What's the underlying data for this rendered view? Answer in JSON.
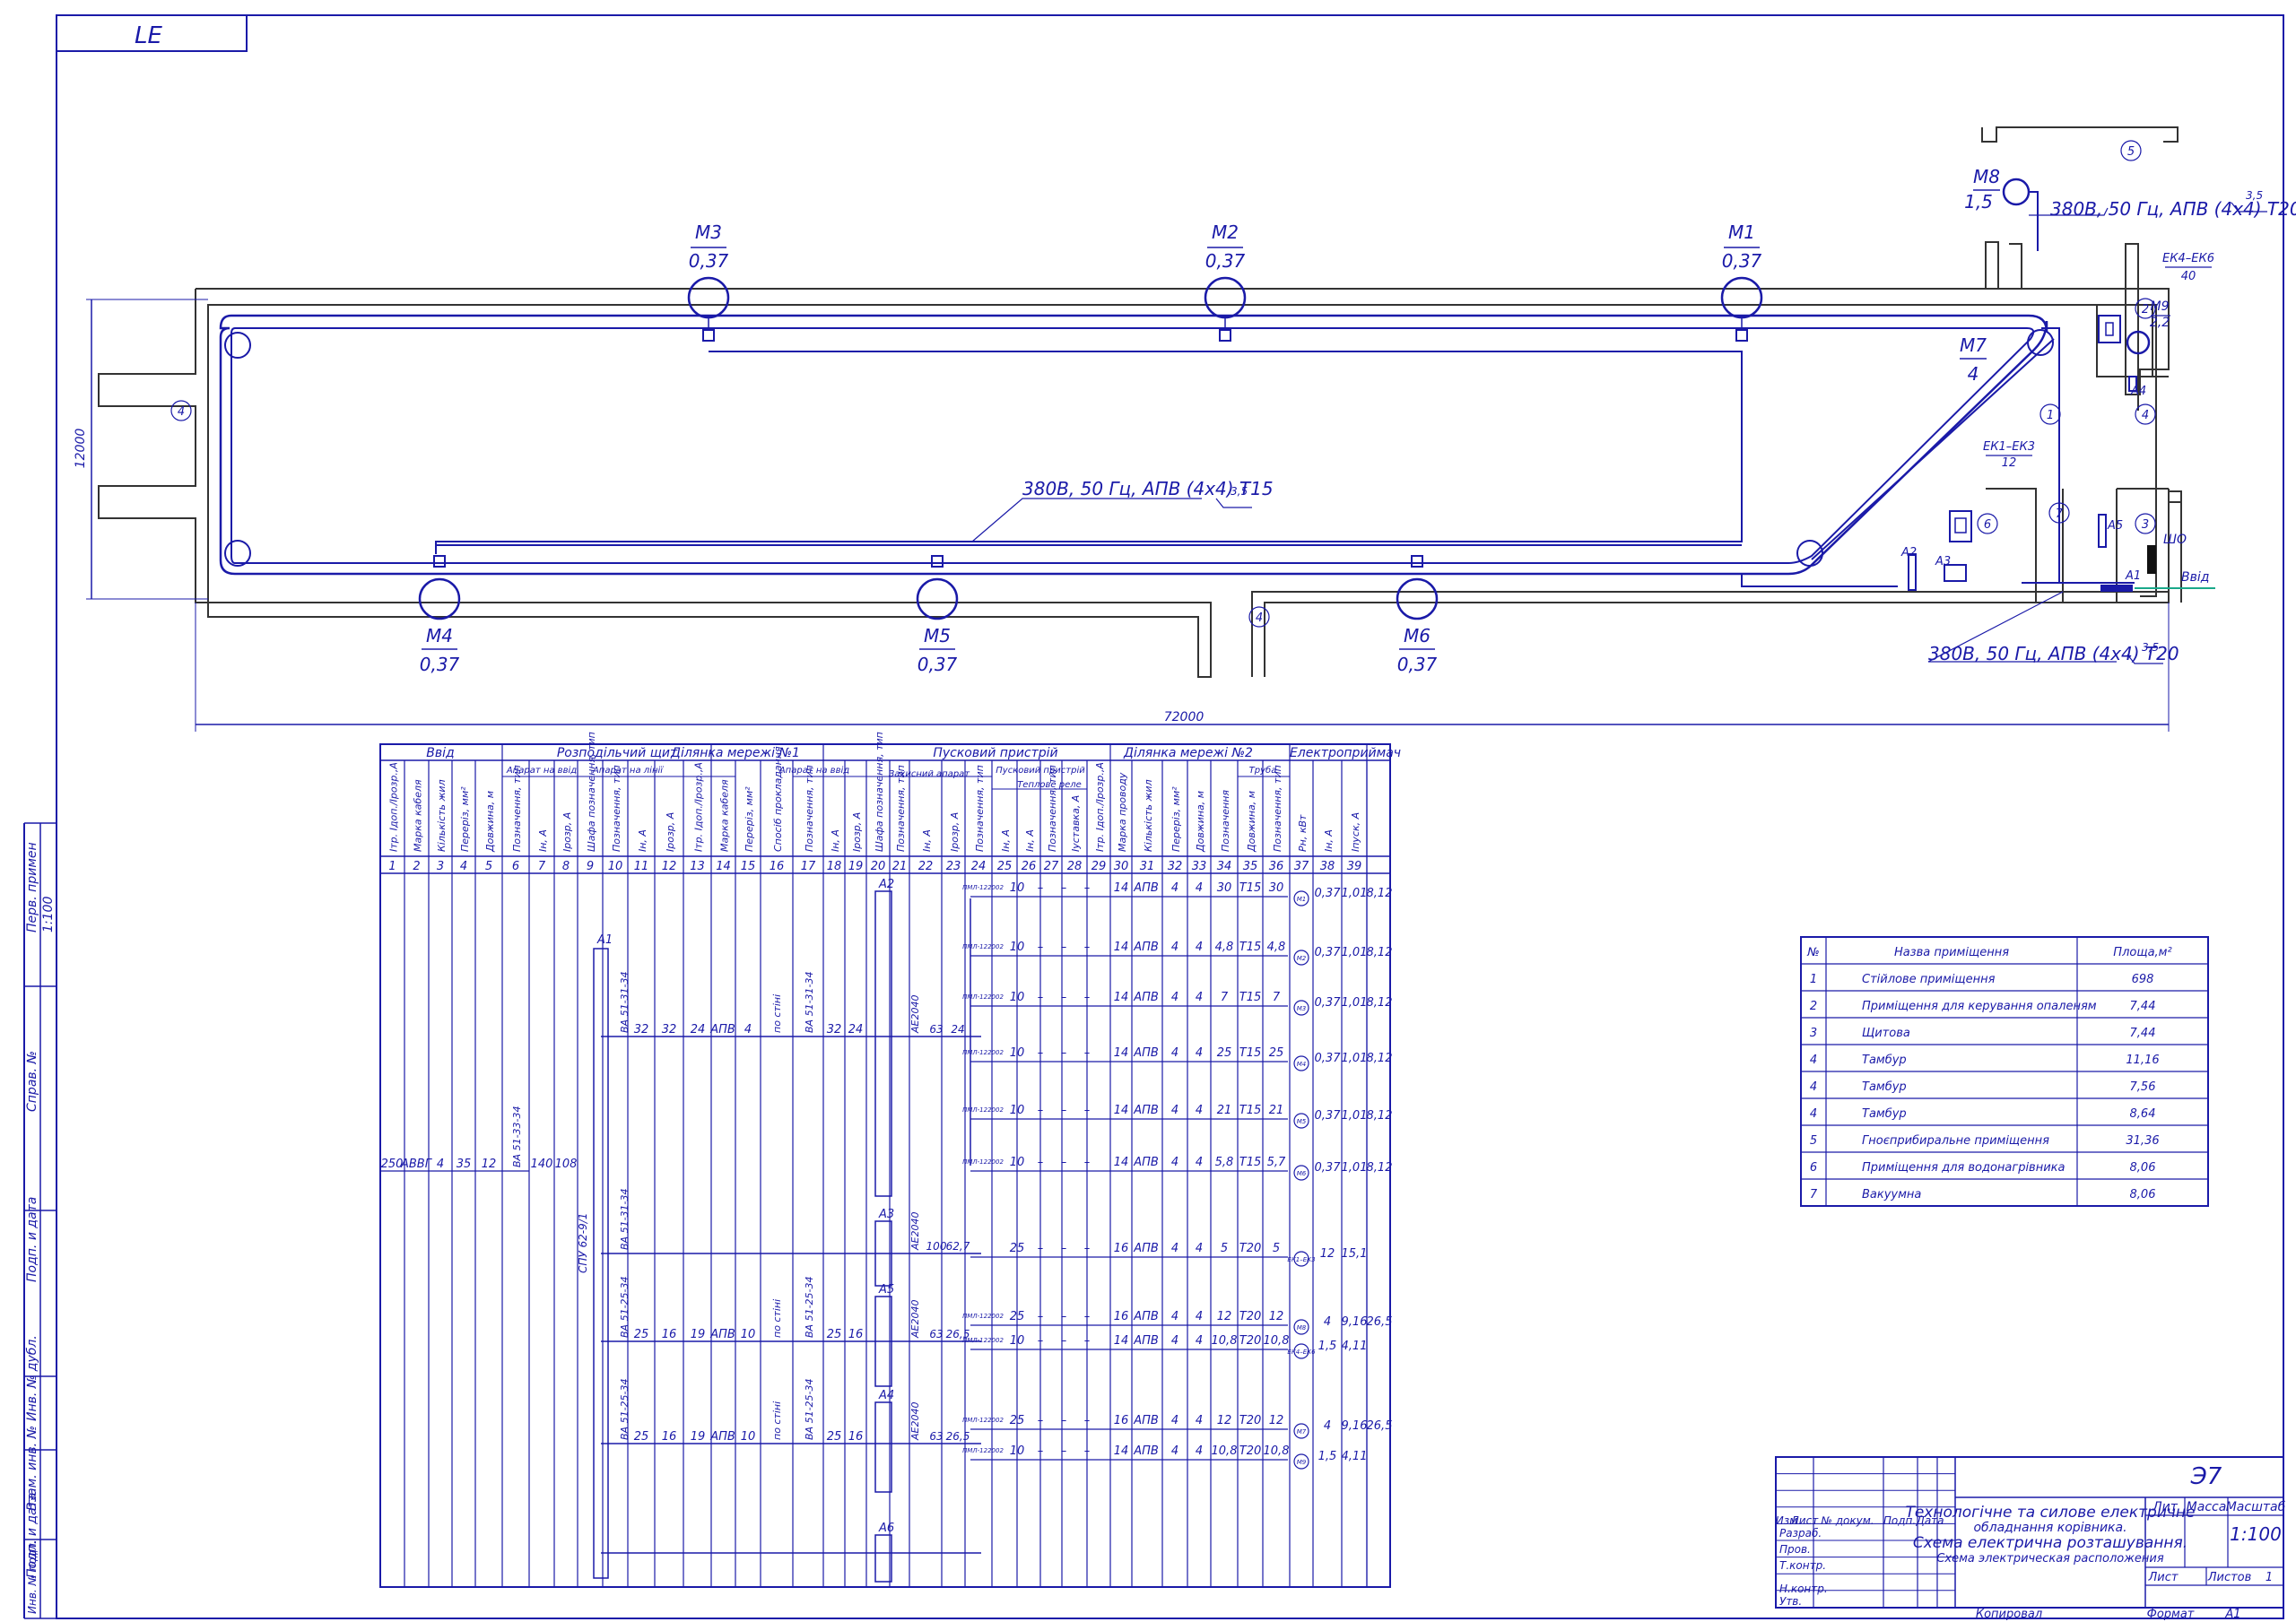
{
  "colors": {
    "frame": "#1a1aa8",
    "wall": "#333333",
    "feed": "#1aa88a",
    "paper": "#ffffff"
  },
  "sheet_code": "LE",
  "left_stamp": [
    "Перв. примен",
    "1:100",
    "Справ. №",
    "Подп. и дата",
    "Инв. № дубл.",
    "Взам. инв. №",
    "Подп. и дата",
    "Инв. № подл."
  ],
  "plan": {
    "motors": [
      {
        "id": "M3",
        "power": "0,37"
      },
      {
        "id": "M2",
        "power": "0,37"
      },
      {
        "id": "M1",
        "power": "0,37"
      },
      {
        "id": "M4",
        "power": "0,37"
      },
      {
        "id": "M5",
        "power": "0,37"
      },
      {
        "id": "M6",
        "power": "0,37"
      },
      {
        "id": "M7",
        "power": "4"
      },
      {
        "id": "M8",
        "power": "1,5"
      },
      {
        "id": "M9",
        "power": "2,2"
      }
    ],
    "heaters": [
      {
        "id": "ЕК4–ЕК6",
        "power": "40"
      },
      {
        "id": "ЕК1–ЕК3",
        "power": "12"
      }
    ],
    "cable_labels": [
      "380В, 50 Гц, АПВ (4х4) Т20",
      "380В, 50 Гц, АПВ (4х4) Т15",
      "380В, 50 Гц, АПВ (4х4) Т20"
    ],
    "cable_marks": [
      "3,5",
      "3,5",
      "3,5"
    ],
    "dim_width": "72000",
    "dim_height": "12000",
    "devices": [
      "А1",
      "А2",
      "А3",
      "А4",
      "А5",
      "ШО"
    ],
    "input_label": "Ввід",
    "room_numbers": [
      "1",
      "2",
      "3",
      "4",
      "4",
      "4",
      "5",
      "6",
      "7"
    ]
  },
  "schedule": {
    "groups": [
      "Ввід",
      "Розподільчий щит",
      "Ділянка мережі №1",
      "Пусковий пристрій",
      "Ділянка мережі №2",
      "Електроприймач"
    ],
    "subgroups": [
      "Апарат на ввід",
      "Апарат на лінії",
      "Апарат на ввід",
      "Захисний апарат",
      "Пусковий пристрій",
      "Теплове реле",
      "Труба"
    ],
    "col_numbers": [
      "1",
      "2",
      "3",
      "4",
      "5",
      "6",
      "7",
      "8",
      "9",
      "10",
      "11",
      "12",
      "13",
      "14",
      "15",
      "16",
      "17",
      "18",
      "19",
      "20",
      "21",
      "22",
      "23",
      "24",
      "25",
      "26",
      "27",
      "28",
      "29",
      "30",
      "31",
      "32",
      "33",
      "34",
      "35",
      "36",
      "37",
      "38",
      "39"
    ],
    "headers": [
      "Ітр. Ідоп./Ірозр.,А",
      "Марка кабеля",
      "Кількість жил",
      "Переріз, мм²",
      "Довжина, м",
      "Позначення, тип",
      "Ін, А",
      "Ірозр, А",
      "Шафа позначення, тип",
      "Позначення, тип",
      "Ін, А",
      "Ірозр, А",
      "Ітр. Ідоп./Ірозр.,А",
      "Марка кабеля",
      "Переріз, мм²",
      "Спосіб прокладання",
      "Позначення, тип",
      "Ін, А",
      "Ірозр, А",
      "Шафа позначення, тип",
      "Позначення, тип",
      "Ін, А",
      "Ірозр, А",
      "Позначення, тип",
      "Ін, А",
      "Ін, А",
      "Позначення, тип",
      "Іуставка, А",
      "Ітр. Ідоп./Ірозр.,А",
      "Марка проводу",
      "Кількість жил",
      "Переріз, мм²",
      "Довжина, м",
      "Позначення",
      "Довжина, м",
      "Позначення, тип",
      "Рн, кВт",
      "Ін, А",
      "Іпуск, А"
    ],
    "input_row": {
      "i": "250",
      "cable": "АВВГ",
      "cores": "4",
      "section": "35",
      "length": "12",
      "breaker": "ВА 51-33-34",
      "in": "140",
      "ir": "108",
      "cabinet": "СПУ 62-9/1"
    },
    "sections": [
      {
        "breaker": "ВА 51-31-34",
        "in": "32",
        "ir": "32",
        "i13": "24",
        "cable": "АПВ",
        "s": "4",
        "way": "по стіні",
        "b2": "ВА 51-31-34",
        "in2": "32",
        "ir2": "24",
        "box": "А2",
        "p": "АЕ2040",
        "pin": "63",
        "pir": "24"
      },
      {
        "breaker": "ВА 51-31-34",
        "box": "А3",
        "p": "АЕ2040",
        "pin": "100",
        "pir": "62,7"
      },
      {
        "breaker": "ВА 51-25-34",
        "in": "25",
        "ir": "16",
        "i13": "19",
        "cable": "АПВ",
        "s": "10",
        "way": "по стіні",
        "b2": "ВА 51-25-34",
        "in2": "25",
        "ir2": "16",
        "box": "А5",
        "p": "АЕ2040",
        "pin": "63",
        "pir": "26,5"
      },
      {
        "breaker": "ВА 51-25-34",
        "in": "25",
        "ir": "16",
        "i13": "19",
        "cable": "АПВ",
        "s": "10",
        "way": "по стіні",
        "b2": "ВА 51-25-34",
        "in2": "25",
        "ir2": "16",
        "box": "А4",
        "p": "АЕ2040",
        "pin": "63",
        "pir": "26,5"
      }
    ],
    "cabinet_extra": [
      "А1",
      "А6"
    ],
    "rows": [
      {
        "starter": "ПМЛ-122002",
        "nc": "10",
        "i": "14",
        "w": "АПВ",
        "n": "4",
        "s": "4",
        "len": "30",
        "pipe": "Т15",
        "plen": "30",
        "m": "М1",
        "p": "0,37",
        "in": "1,01",
        "ip": "8,12"
      },
      {
        "starter": "ПМЛ-122002",
        "nc": "10",
        "i": "14",
        "w": "АПВ",
        "n": "4",
        "s": "4",
        "len": "4,8",
        "pipe": "Т15",
        "plen": "4,8",
        "m": "М2",
        "p": "0,37",
        "in": "1,01",
        "ip": "8,12"
      },
      {
        "starter": "ПМЛ-122002",
        "nc": "10",
        "i": "14",
        "w": "АПВ",
        "n": "4",
        "s": "4",
        "len": "7",
        "pipe": "Т15",
        "plen": "7",
        "m": "М3",
        "p": "0,37",
        "in": "1,01",
        "ip": "8,12"
      },
      {
        "starter": "ПМЛ-122002",
        "nc": "10",
        "i": "14",
        "w": "АПВ",
        "n": "4",
        "s": "4",
        "len": "25",
        "pipe": "Т15",
        "plen": "25",
        "m": "М4",
        "p": "0,37",
        "in": "1,01",
        "ip": "8,12"
      },
      {
        "starter": "ПМЛ-122002",
        "nc": "10",
        "i": "14",
        "w": "АПВ",
        "n": "4",
        "s": "4",
        "len": "21",
        "pipe": "Т15",
        "plen": "21",
        "m": "М5",
        "p": "0,37",
        "in": "1,01",
        "ip": "8,12"
      },
      {
        "starter": "ПМЛ-122002",
        "nc": "10",
        "i": "14",
        "w": "АПВ",
        "n": "4",
        "s": "4",
        "len": "5,8",
        "pipe": "Т15",
        "plen": "5,7",
        "m": "М6",
        "p": "0,37",
        "in": "1,01",
        "ip": "8,12"
      },
      {
        "starter": "",
        "nc": "25",
        "i": "16",
        "w": "АПВ",
        "n": "4",
        "s": "4",
        "len": "5",
        "pipe": "Т20",
        "plen": "5",
        "m": "ЕК1–ЕК3",
        "p": "12",
        "in": "15,1",
        "ip": ""
      },
      {
        "starter": "ПМЛ-122002",
        "nc": "25",
        "i": "16",
        "w": "АПВ",
        "n": "4",
        "s": "4",
        "len": "12",
        "pipe": "Т20",
        "plen": "12",
        "m": "М8",
        "p": "4",
        "in": "9,16",
        "ip": "26,5"
      },
      {
        "starter": "ПМЛ-122002",
        "nc": "10",
        "i": "14",
        "w": "АПВ",
        "n": "4",
        "s": "4",
        "len": "10,8",
        "pipe": "Т20",
        "plen": "10,8",
        "m": "ЕК4–ЕК6",
        "p": "1,5",
        "in": "4,11",
        "ip": ""
      },
      {
        "starter": "ПМЛ-122002",
        "nc": "25",
        "i": "16",
        "w": "АПВ",
        "n": "4",
        "s": "4",
        "len": "12",
        "pipe": "Т20",
        "plen": "12",
        "m": "М7",
        "p": "4",
        "in": "9,16",
        "ip": "26,5"
      },
      {
        "starter": "ПМЛ-122002",
        "nc": "10",
        "i": "14",
        "w": "АПВ",
        "n": "4",
        "s": "4",
        "len": "10,8",
        "pipe": "Т20",
        "plen": "10,8",
        "m": "М9",
        "p": "1,5",
        "in": "4,11",
        "ip": ""
      }
    ],
    "dash": "–"
  },
  "rooms": {
    "headers": [
      "№",
      "Назва приміщення",
      "Площа,м²"
    ],
    "rows": [
      [
        "1",
        "Стійлове приміщення",
        "698"
      ],
      [
        "2",
        "Приміщення для керування опаленям",
        "7,44"
      ],
      [
        "3",
        "Щитова",
        "7,44"
      ],
      [
        "4",
        "Тамбур",
        "11,16"
      ],
      [
        "4",
        "Тамбур",
        "7,56"
      ],
      [
        "4",
        "Тамбур",
        "8,64"
      ],
      [
        "5",
        "Гноєприбиральне приміщення",
        "31,36"
      ],
      [
        "6",
        "Приміщення для водонагрівника",
        "8,06"
      ],
      [
        "7",
        "Вакуумна",
        "8,06"
      ]
    ]
  },
  "title_block": {
    "code": "Э7",
    "title1": "Технологічне та силове електричне",
    "title2": "обладнання корівника.",
    "title3": "Схема електрична розташування.",
    "title4": "Схема электрическая расположения",
    "lit": "Лит",
    "mass": "Масса",
    "scale_h": "Масштаб",
    "scale": "1:100",
    "sheet": "Лист",
    "sheets": "Листов",
    "sheets_n": "1",
    "roles": [
      "Изм",
      "Лист",
      "№ докум.",
      "Подп.",
      "Дата"
    ],
    "people": [
      "Разраб.",
      "Пров.",
      "Т.контр.",
      "",
      "Н.контр.",
      "Утв."
    ],
    "copied": "Копировал",
    "format": "Формат",
    "format_v": "А1"
  }
}
